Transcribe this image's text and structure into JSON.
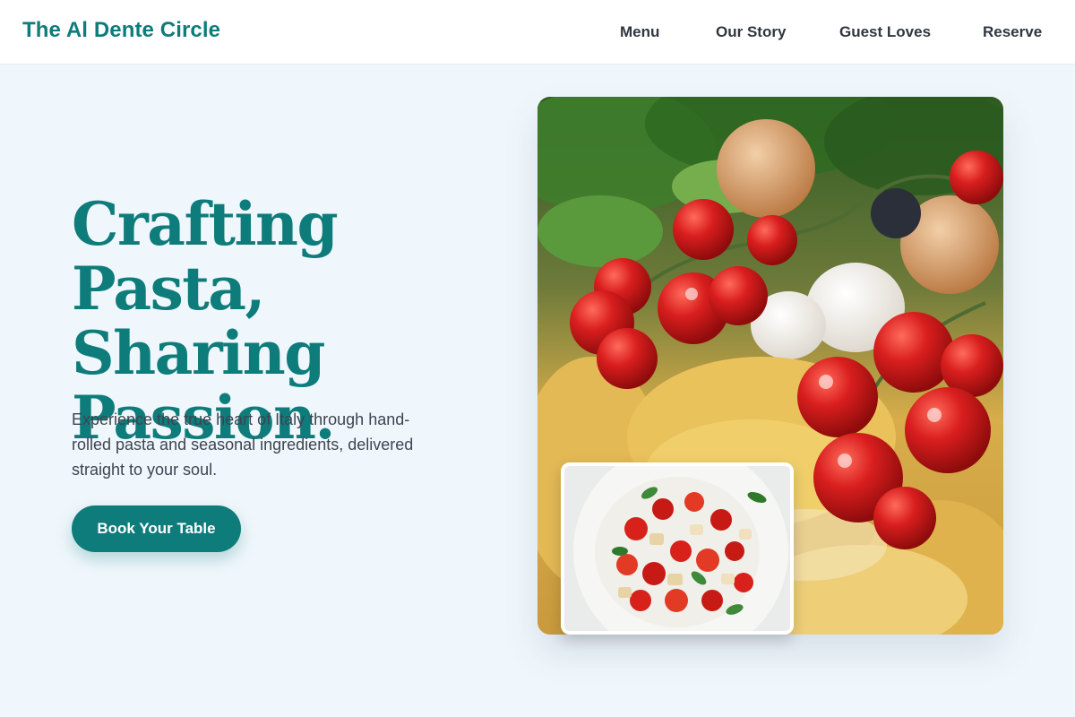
{
  "header": {
    "brand": "The Al Dente Circle",
    "nav": [
      "Menu",
      "Our Story",
      "Guest Loves",
      "Reserve"
    ]
  },
  "hero": {
    "title_lines": [
      "Crafting Pasta,",
      "Sharing",
      "Passion."
    ],
    "description": "Experience the true heart of Italy through hand-rolled pasta and seasonal ingredients, delivered straight to your soul.",
    "cta_label": "Book Your Table",
    "main_image": "pasta-and-tomatoes-photo",
    "inset_image": "tomato-bread-salad-photo"
  },
  "colors": {
    "accent": "#0e7c7b",
    "background": "#f0f7fc",
    "text": "#3d4450"
  }
}
